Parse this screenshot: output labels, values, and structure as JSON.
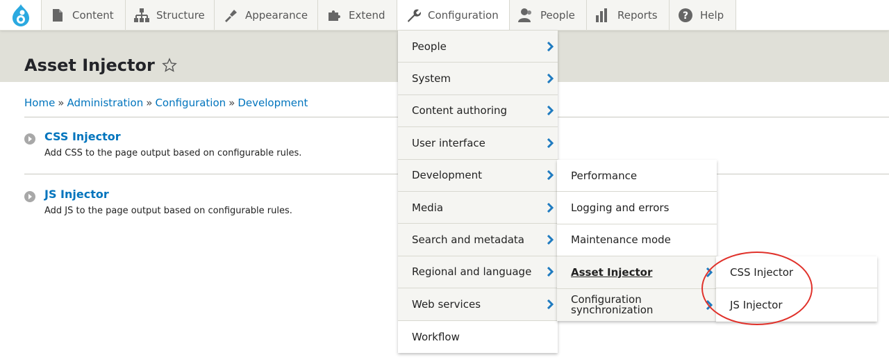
{
  "toolbar": {
    "logo": "drupal-drop-icon",
    "tabs": [
      {
        "label": "Content",
        "icon": "page-icon"
      },
      {
        "label": "Structure",
        "icon": "structure-icon"
      },
      {
        "label": "Appearance",
        "icon": "paintbrush-icon"
      },
      {
        "label": "Extend",
        "icon": "puzzle-icon"
      },
      {
        "label": "Configuration",
        "icon": "wrench-icon"
      },
      {
        "label": "People",
        "icon": "people-icon"
      },
      {
        "label": "Reports",
        "icon": "bar-chart-icon"
      },
      {
        "label": "Help",
        "icon": "help-icon"
      }
    ]
  },
  "page": {
    "title": "Asset Injector",
    "breadcrumb": [
      "Home",
      "Administration",
      "Configuration",
      "Development"
    ],
    "breadcrumb_separator": "»",
    "items": [
      {
        "title": "CSS Injector",
        "description": "Add CSS to the page output based on configurable rules."
      },
      {
        "title": "JS Injector",
        "description": "Add JS to the page output based on configurable rules."
      }
    ]
  },
  "menus": {
    "configuration": [
      "People",
      "System",
      "Content authoring",
      "User interface",
      "Development",
      "Media",
      "Search and metadata",
      "Regional and language",
      "Web services",
      "Workflow"
    ],
    "development": [
      "Performance",
      "Logging and errors",
      "Maintenance mode",
      "Asset Injector",
      "Configuration synchronization"
    ],
    "asset_injector": [
      "CSS Injector",
      "JS Injector"
    ]
  },
  "colors": {
    "link": "#0074bd",
    "chevron": "#1f7bc0",
    "band": "#e0e0d8",
    "annotation": "#e0312a"
  }
}
